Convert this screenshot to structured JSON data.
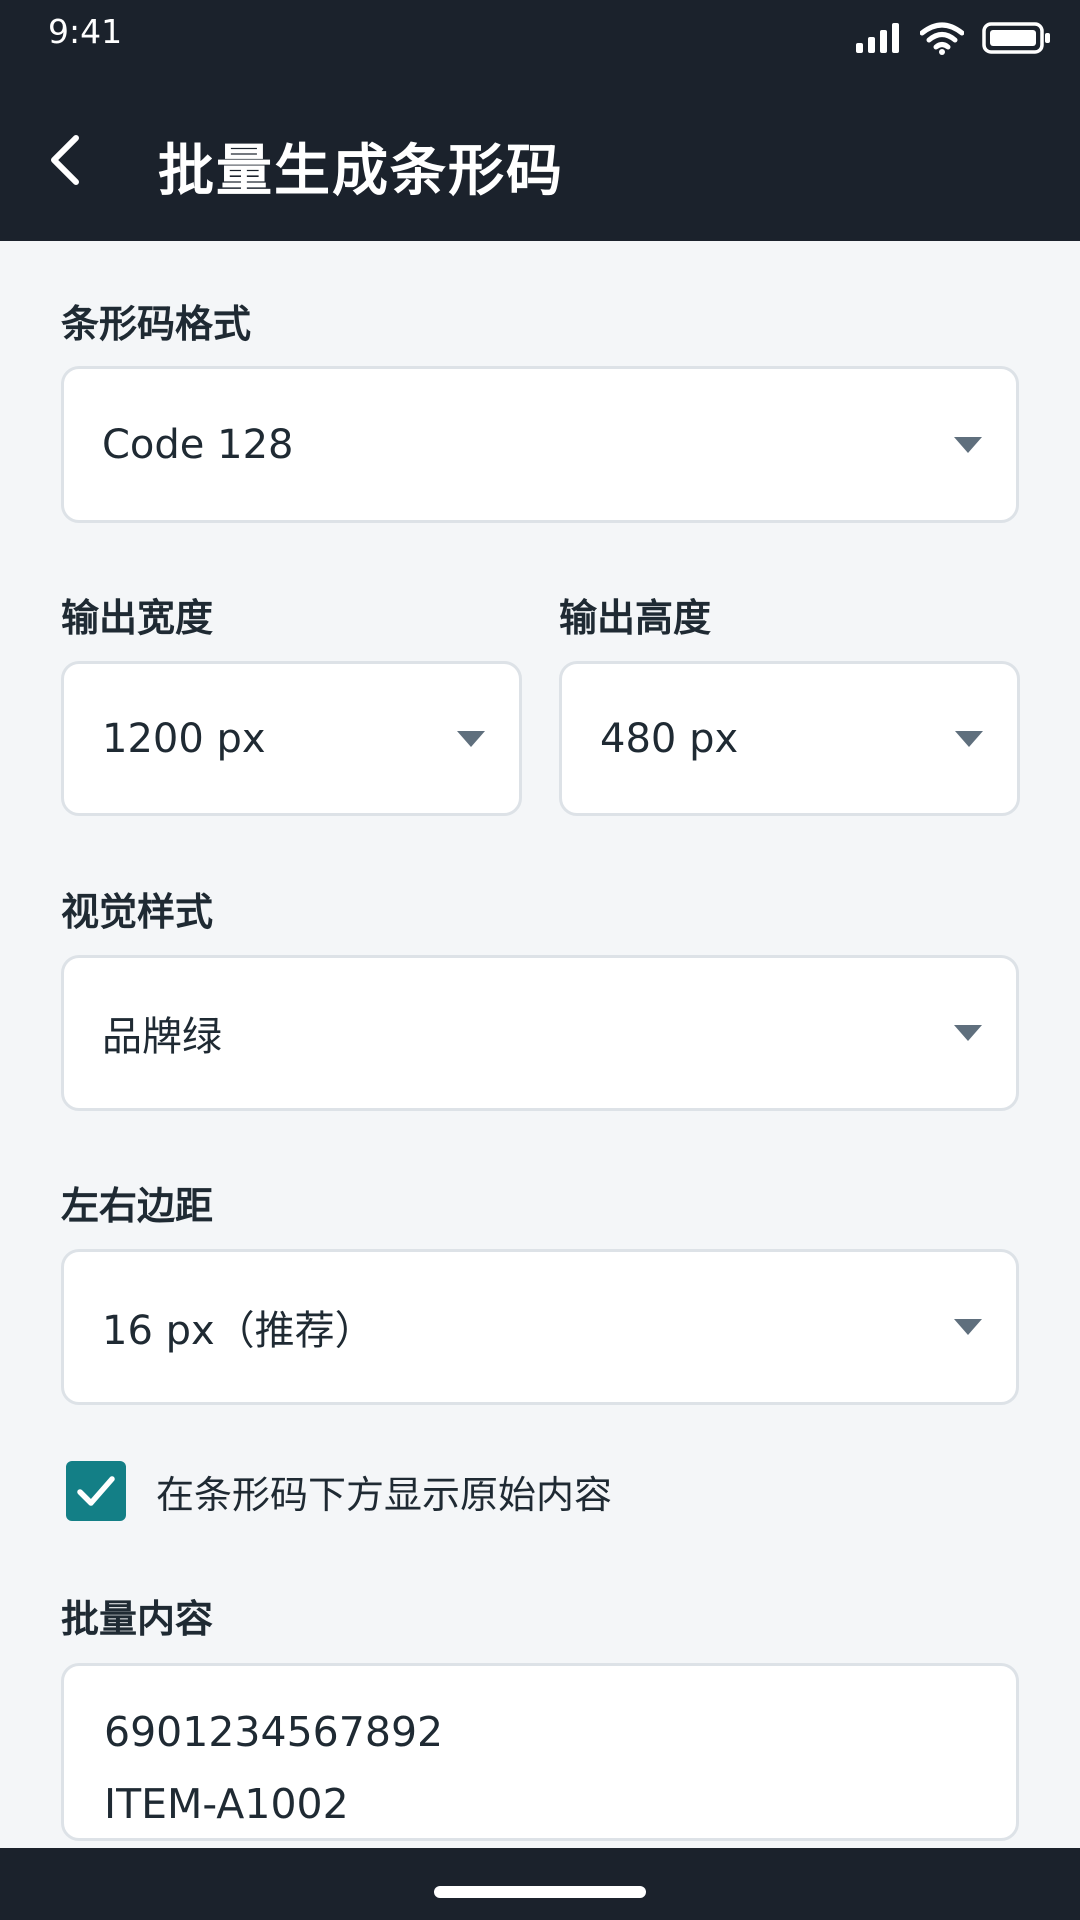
{
  "status_bar": {
    "time": "9:41",
    "icons": [
      "signal-icon",
      "wifi-icon",
      "battery-icon"
    ]
  },
  "header": {
    "title": "批量生成条形码",
    "back_icon": "chevron-left-icon"
  },
  "form": {
    "format": {
      "label": "条形码格式",
      "value": "Code 128"
    },
    "width": {
      "label": "输出宽度",
      "value": "1200 px"
    },
    "height": {
      "label": "输出高度",
      "value": "480 px"
    },
    "style": {
      "label": "视觉样式",
      "value": "品牌绿"
    },
    "margin": {
      "label": "左右边距",
      "value": "16 px（推荐）"
    },
    "show_text": {
      "label": "在条形码下方显示原始内容",
      "checked": true
    },
    "batch": {
      "label": "批量内容",
      "lines": [
        "6901234567892",
        "ITEM-A1002"
      ]
    }
  },
  "colors": {
    "header_bg": "#1b222c",
    "page_bg": "#f4f6f8",
    "accent": "#137f86",
    "border": "#dde2e7",
    "caret": "#5f6f7d"
  }
}
